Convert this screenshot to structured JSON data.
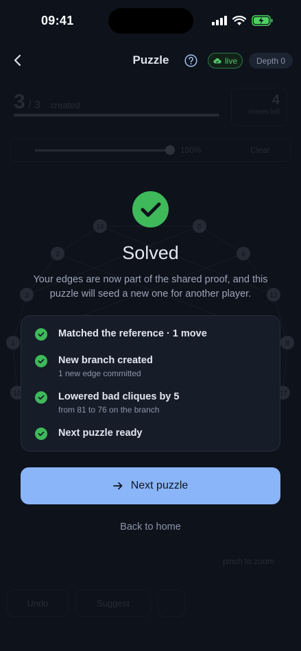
{
  "status_bar": {
    "time": "09:41"
  },
  "header": {
    "title": "Puzzle",
    "live_label": "live",
    "depth_label": "Depth 0"
  },
  "background": {
    "progress_current": "3",
    "progress_total": "/ 3",
    "progress_label": "created",
    "moves_count": "4",
    "moves_label": "moves left",
    "slider_pct": "100%",
    "clear_label": "Clear",
    "node_labels": [
      "14",
      "5",
      "2",
      "6",
      "3",
      "12",
      "1",
      "8",
      "10",
      "17"
    ],
    "pinch_hint": "pinch to zoom",
    "toolbar": [
      "Undo",
      "Suggest"
    ]
  },
  "success": {
    "title": "Solved",
    "description": "Your edges are now part of the shared proof, and this puzzle will seed a new one for another player.",
    "items": [
      {
        "main": "Matched the reference · 1 move",
        "sub": ""
      },
      {
        "main": "New branch created",
        "sub": "1 new edge committed"
      },
      {
        "main": "Lowered bad cliques by 5",
        "sub": "from 81 to 76 on the branch"
      },
      {
        "main": "Next puzzle ready",
        "sub": ""
      }
    ],
    "next_button": "Next puzzle",
    "back_link": "Back to home"
  },
  "colors": {
    "accent": "#8ab5f8",
    "success": "#3fb95a",
    "background": "#0d121b"
  }
}
